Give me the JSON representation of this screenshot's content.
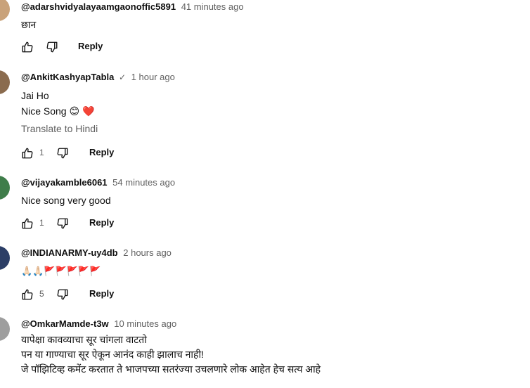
{
  "comments": [
    {
      "author": "@adarshvidyalayaamgaonoffic5891",
      "time": "41 minutes ago",
      "lines": [
        "छान"
      ],
      "likes": "",
      "reply_label": "Reply",
      "avatar_color": "#c9a27a"
    },
    {
      "author": "@AnkitKashyapTabla",
      "verified_icon": "check-icon",
      "time": "1 hour ago",
      "lines": [
        "Jai Ho",
        "Nice Song 😊 ❤️"
      ],
      "translate": "Translate to Hindi",
      "likes": "1",
      "reply_label": "Reply",
      "avatar_color": "#8a6b4e"
    },
    {
      "author": "@vijayakamble6061",
      "time": "54 minutes ago",
      "lines": [
        "Nice song very good"
      ],
      "likes": "1",
      "reply_label": "Reply",
      "avatar_color": "#3f7d4a"
    },
    {
      "author": "@INDIANARMY-uy4db",
      "time": "2 hours ago",
      "lines": [
        "🙏🏻🙏🏻🚩🚩🚩🚩🚩"
      ],
      "likes": "5",
      "reply_label": "Reply",
      "avatar_color": "#2c3e66"
    },
    {
      "author": "@OmkarMamde-t3w",
      "time": "10 minutes ago",
      "lines": [
        "यापेक्षा कावव्याचा सूर चांगला वाटतो",
        "पन या गाण्याचा सूर ऐकून आनंद काही झालाच नाही!",
        "जे पॉझिटिव्ह कमेंट करतात ते भाजपच्या सतरंज्या उचलणारे लोक आहेत हेच सत्य आहे"
      ],
      "avatar_color": "#9e9e9e"
    }
  ]
}
